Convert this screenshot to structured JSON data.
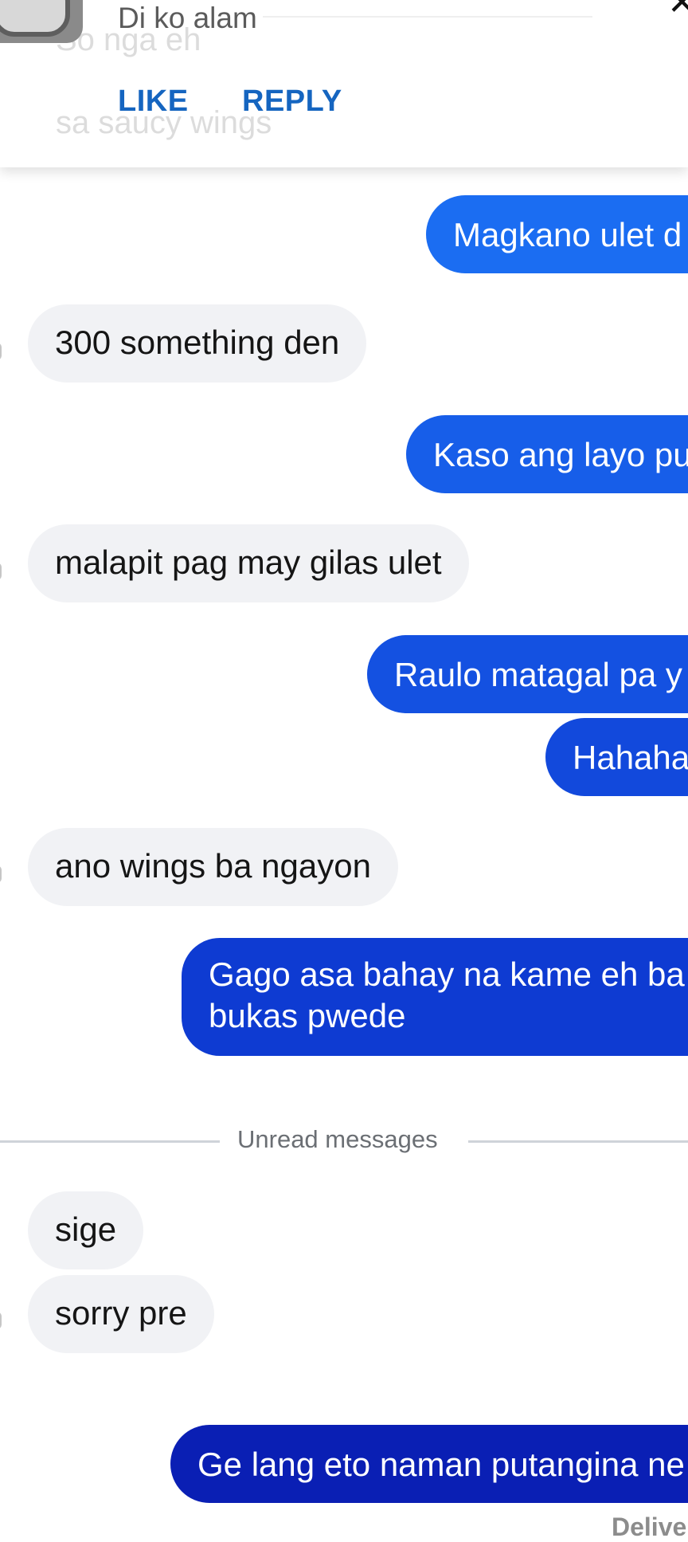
{
  "notification": {
    "message": "Di ko alam",
    "ghost_lines": [
      "So nga eh",
      "sa saucy wings"
    ],
    "like_label": "LIKE",
    "reply_label": "REPLY"
  },
  "messages": [
    {
      "side": "out",
      "text": "Magkano ulet d"
    },
    {
      "side": "in",
      "text": "300 something den"
    },
    {
      "side": "out",
      "text": "Kaso ang layo pu"
    },
    {
      "side": "in",
      "text": "malapit pag may gilas ulet"
    },
    {
      "side": "out",
      "text": "Raulo matagal pa y"
    },
    {
      "side": "out",
      "text": "Hahaha"
    },
    {
      "side": "in",
      "text": "ano wings ba ngayon"
    },
    {
      "side": "out",
      "text": "Gago asa bahay na kame eh ba bukas pwede"
    },
    {
      "side": "in",
      "text": "sige"
    },
    {
      "side": "in",
      "text": "sorry pre"
    },
    {
      "side": "out",
      "text": "Ge lang eto naman putangina ne"
    }
  ],
  "divider": {
    "label": "Unread messages"
  },
  "status": {
    "delivered": "Deliver"
  },
  "colors": {
    "bubble_in": "#f1f2f5",
    "gradient": [
      "#1a6cf0",
      "#1040d6",
      "#0a1fb4"
    ],
    "action_blue": "#1565c0"
  }
}
